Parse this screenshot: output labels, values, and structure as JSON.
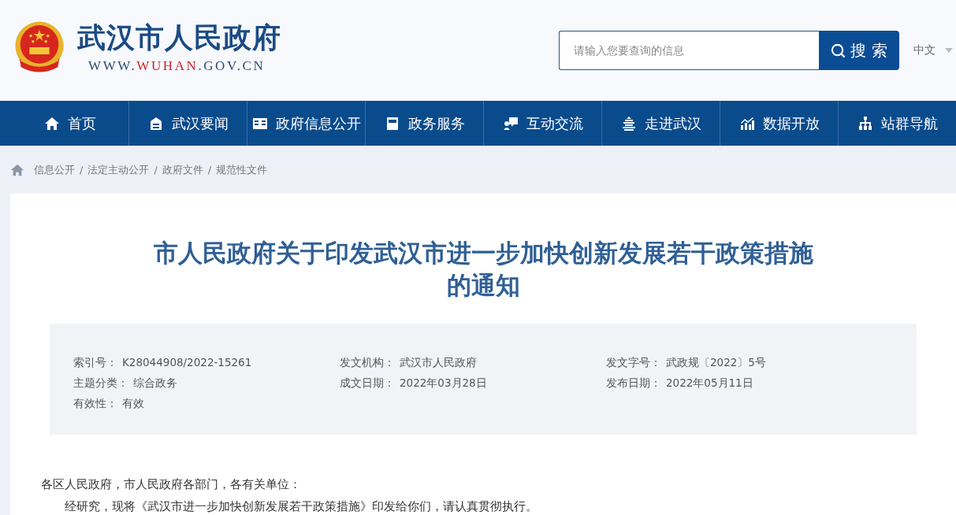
{
  "header": {
    "site_name": "武汉市人民政府",
    "domain_parts": [
      {
        "text": "WWW.",
        "highlight": false
      },
      {
        "text": "WUHAN",
        "highlight": true
      },
      {
        "text": ".GOV.CN",
        "highlight": false
      }
    ],
    "search": {
      "placeholder": "请输入您要查询的信息",
      "button": "搜 索"
    },
    "language": "中文"
  },
  "nav": [
    {
      "label": "首页"
    },
    {
      "label": "武汉要闻"
    },
    {
      "label": "政府信息公开"
    },
    {
      "label": "政务服务"
    },
    {
      "label": "互动交流"
    },
    {
      "label": "走进武汉"
    },
    {
      "label": "数据开放"
    },
    {
      "label": "站群导航"
    }
  ],
  "breadcrumb": [
    {
      "label": "信息公开"
    },
    {
      "separator": "/",
      "label": "法定主动公开"
    },
    {
      "separator": "/",
      "label": "政府文件"
    },
    {
      "separator": "/",
      "label": "规范性文件"
    }
  ],
  "article": {
    "title_lines": [
      "市人民政府关于印发武汉市进一步加快创新发展若干政策措施",
      "的通知"
    ],
    "meta": [
      {
        "label": "索引号：",
        "value": "K28044908/2022-15261"
      },
      {
        "label": "发文机构：",
        "value": "武汉市人民政府"
      },
      {
        "label": "发文字号：",
        "value": "武政规〔2022〕5号"
      },
      {
        "label": "主题分类：",
        "value": "综合政务"
      },
      {
        "label": "成文日期：",
        "value": "2022年03月28日"
      },
      {
        "label": "发布日期：",
        "value": "2022年05月11日"
      },
      {
        "label": "有效性：",
        "value": "有效"
      }
    ],
    "paragraphs": [
      {
        "text": "各区人民政府，市人民政府各部门，各有关单位：",
        "indent": false
      },
      {
        "text": "经研究，现将《武汉市进一步加快创新发展若干政策措施》印发给你们，请认真贯彻执行。",
        "indent": true
      }
    ]
  }
}
